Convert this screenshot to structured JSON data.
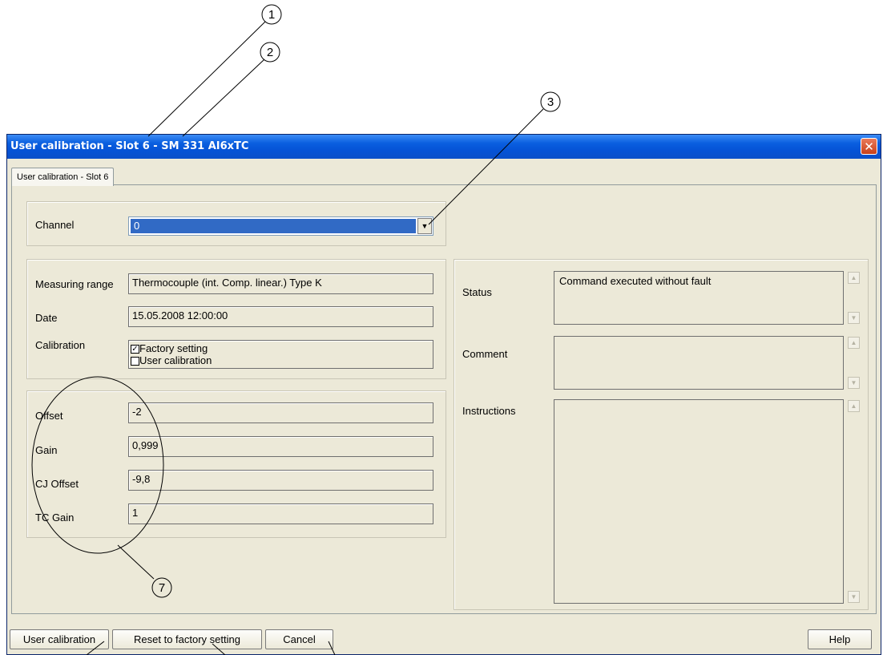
{
  "window": {
    "title": "User calibration - Slot 6 - SM 331 AI6xTC",
    "close_glyph": "✕"
  },
  "tab": {
    "label": "User calibration - Slot 6"
  },
  "channel": {
    "label": "Channel",
    "value": "0",
    "arrow": "▼"
  },
  "info": {
    "measuring_range_label": "Measuring range",
    "measuring_range_value": "Thermocouple (int. Comp. linear.) Type K",
    "date_label": "Date",
    "date_value": "15.05.2008 12:00:00",
    "calibration_label": "Calibration",
    "factory_setting_label": "Factory setting",
    "factory_setting_checked": true,
    "user_calibration_label": "User calibration",
    "user_calibration_checked": false
  },
  "params": {
    "offset_label": "Offset",
    "offset_value": "-2",
    "gain_label": "Gain",
    "gain_value": "0,999",
    "cj_offset_label": "CJ Offset",
    "cj_offset_value": "-9,8",
    "tc_gain_label": "TC Gain",
    "tc_gain_value": "1"
  },
  "right_panel": {
    "status_label": "Status",
    "status_value": "Command executed without fault",
    "comment_label": "Comment",
    "comment_value": "",
    "instructions_label": "Instructions",
    "instructions_value": ""
  },
  "buttons": {
    "user_calibration": "User calibration",
    "reset_factory": "Reset to factory setting",
    "cancel": "Cancel",
    "help": "Help"
  },
  "callouts": [
    "1",
    "2",
    "3",
    "7"
  ],
  "icons": {
    "checkmark": "✓",
    "scroll_up": "▲",
    "scroll_down": "▼"
  }
}
